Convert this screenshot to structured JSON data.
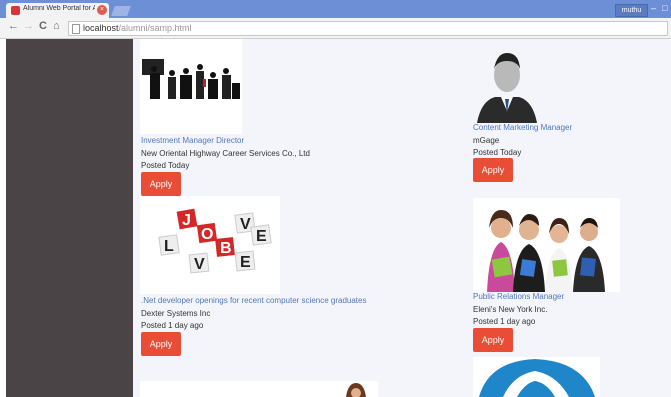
{
  "browser": {
    "tab_title": "Alumni Web Portal for Al",
    "tab_close": "×",
    "user_badge": "muthu",
    "window_min": "–",
    "window_max": "□",
    "nav_back": "←",
    "nav_forward": "→",
    "nav_reload": "C",
    "nav_home": "⌂",
    "url_host": "localhost",
    "url_path": "/alumni/samp.html"
  },
  "jobs": [
    {
      "title": "Investment Manager Director",
      "company": "New Oriental Highway Career Services Co., Ltd",
      "posted": "Posted Today",
      "apply": "Apply"
    },
    {
      "title": "Content Marketing Manager",
      "company": "mGage",
      "posted": "Posted Today",
      "apply": "Apply"
    },
    {
      "title": ".Net developer openings for recent computer science graduates",
      "company": "Dexter Systems Inc",
      "posted": "Posted 1 day ago",
      "apply": "Apply"
    },
    {
      "title": "Public Relations Manager",
      "company": "Eleni's New York Inc.",
      "posted": "Posted 1 day ago",
      "apply": "Apply"
    }
  ],
  "colors": {
    "accent": "#e94d35",
    "link": "#4e79c0",
    "sidebar": "#4b4447",
    "titlebar": "#6d8fd6"
  },
  "icons": [
    "favicon-icon",
    "close-icon",
    "back-icon",
    "forward-icon",
    "reload-icon",
    "home-icon",
    "page-icon"
  ]
}
